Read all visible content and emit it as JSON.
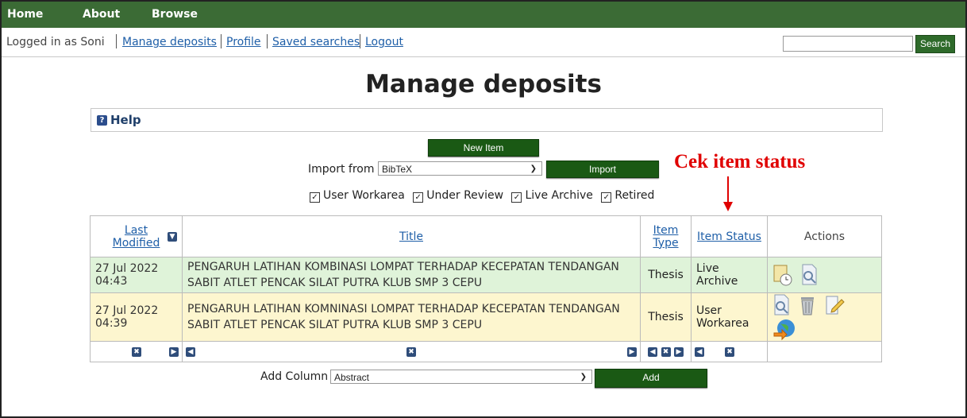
{
  "nav": {
    "home": "Home",
    "about": "About",
    "browse": "Browse"
  },
  "login": {
    "text": "Logged in as Soni",
    "links": [
      "Manage deposits",
      "Profile",
      "Saved searches",
      "Logout"
    ]
  },
  "search": {
    "button": "Search",
    "value": ""
  },
  "page_title": "Manage deposits",
  "help": "Help",
  "new_item": "New Item",
  "import": {
    "label": "Import from",
    "selected": "BibTeX",
    "button": "Import"
  },
  "filters": [
    "User Workarea",
    "Under Review",
    "Live Archive",
    "Retired"
  ],
  "annotation": "Cek item status",
  "table": {
    "headers": {
      "last_modified": "Last Modified",
      "title": "Title",
      "item_type": "Item Type",
      "item_status": "Item Status",
      "actions": "Actions"
    },
    "rows": [
      {
        "date": "27 Jul 2022 04:43",
        "title": "PENGARUH LATIHAN KOMBINASI LOMPAT TERHADAP KECEPATAN TENDANGAN SABIT ATLET PENCAK SILAT PUTRA KLUB SMP 3 CEPU",
        "type": "Thesis",
        "status": "Live Archive"
      },
      {
        "date": "27 Jul 2022 04:39",
        "title": "PENGARUH LATIHAN KOMNINASI LOMPAT TERHADAP KECEPATAN TENDANGAN SABIT ATLET PENCAK SILAT PUTRA KLUB SMP 3 CEPU",
        "type": "Thesis",
        "status": "User Workarea"
      }
    ]
  },
  "add_column": {
    "label": "Add Column",
    "selected": "Abstract",
    "button": "Add"
  },
  "colors": {
    "nav": "#3b6b35",
    "button": "#1a5914",
    "row_live": "#dff3d9",
    "row_user": "#fdf6cf",
    "annotation": "#e00000",
    "link": "#1f5fa8"
  }
}
